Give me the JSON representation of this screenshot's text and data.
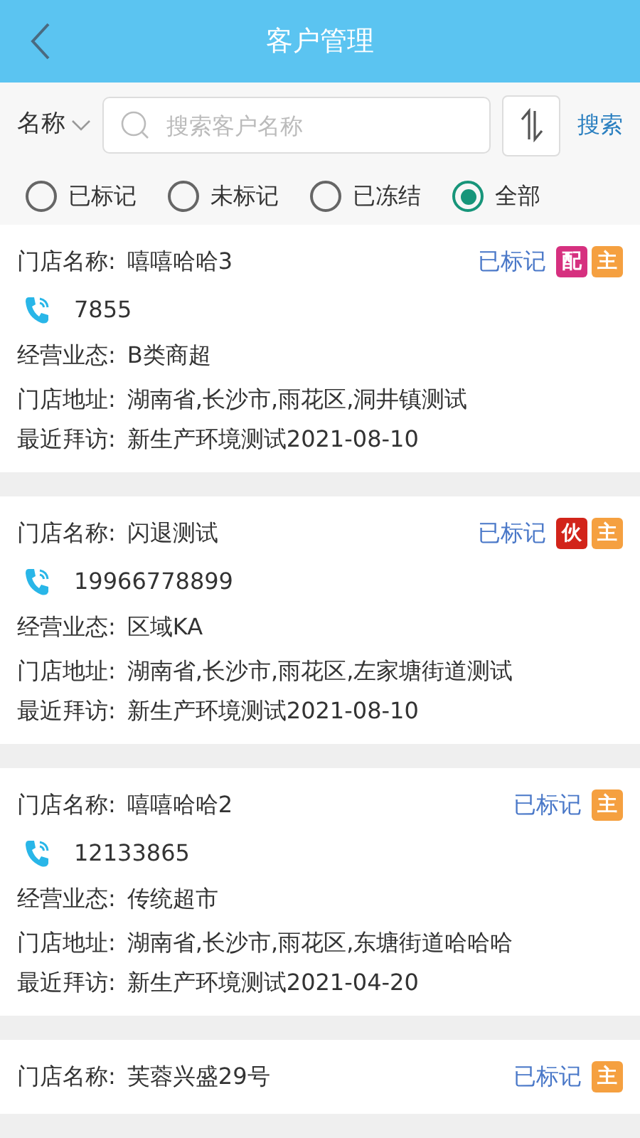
{
  "header": {
    "title": "客户管理"
  },
  "search": {
    "field_label": "名称",
    "placeholder": "搜索客户名称",
    "action": "搜索"
  },
  "filters": [
    {
      "label": "已标记",
      "selected": false
    },
    {
      "label": "未标记",
      "selected": false
    },
    {
      "label": "已冻结",
      "selected": false
    },
    {
      "label": "全部",
      "selected": true
    }
  ],
  "customers": [
    {
      "name_label": "门店名称:",
      "name": "嘻嘻哈哈3",
      "status": "已标记",
      "tags": [
        {
          "text": "配",
          "color": "#d6307f"
        },
        {
          "text": "主",
          "color": "#f5a040"
        }
      ],
      "phone": "7855",
      "type_label": "经营业态:",
      "type": "B类商超",
      "address_label": "门店地址:",
      "address": "湖南省,长沙市,雨花区,洞井镇测试",
      "visit_label": "最近拜访:",
      "visit": "新生产环境测试2021-08-10"
    },
    {
      "name_label": "门店名称:",
      "name": "闪退测试",
      "status": "已标记",
      "tags": [
        {
          "text": "伙",
          "color": "#d2241a"
        },
        {
          "text": "主",
          "color": "#f5a040"
        }
      ],
      "phone": "19966778899",
      "type_label": "经营业态:",
      "type": "区域KA",
      "address_label": "门店地址:",
      "address": "湖南省,长沙市,雨花区,左家塘街道测试",
      "visit_label": "最近拜访:",
      "visit": "新生产环境测试2021-08-10"
    },
    {
      "name_label": "门店名称:",
      "name": "嘻嘻哈哈2",
      "status": "已标记",
      "tags": [
        {
          "text": "主",
          "color": "#f5a040"
        }
      ],
      "phone": "12133865",
      "type_label": "经营业态:",
      "type": "传统超市",
      "address_label": "门店地址:",
      "address": "湖南省,长沙市,雨花区,东塘街道哈哈哈",
      "visit_label": "最近拜访:",
      "visit": "新生产环境测试2021-04-20"
    },
    {
      "name_label": "门店名称:",
      "name": "芙蓉兴盛29号",
      "status": "已标记",
      "tags": [
        {
          "text": "主",
          "color": "#f5a040"
        }
      ]
    }
  ]
}
